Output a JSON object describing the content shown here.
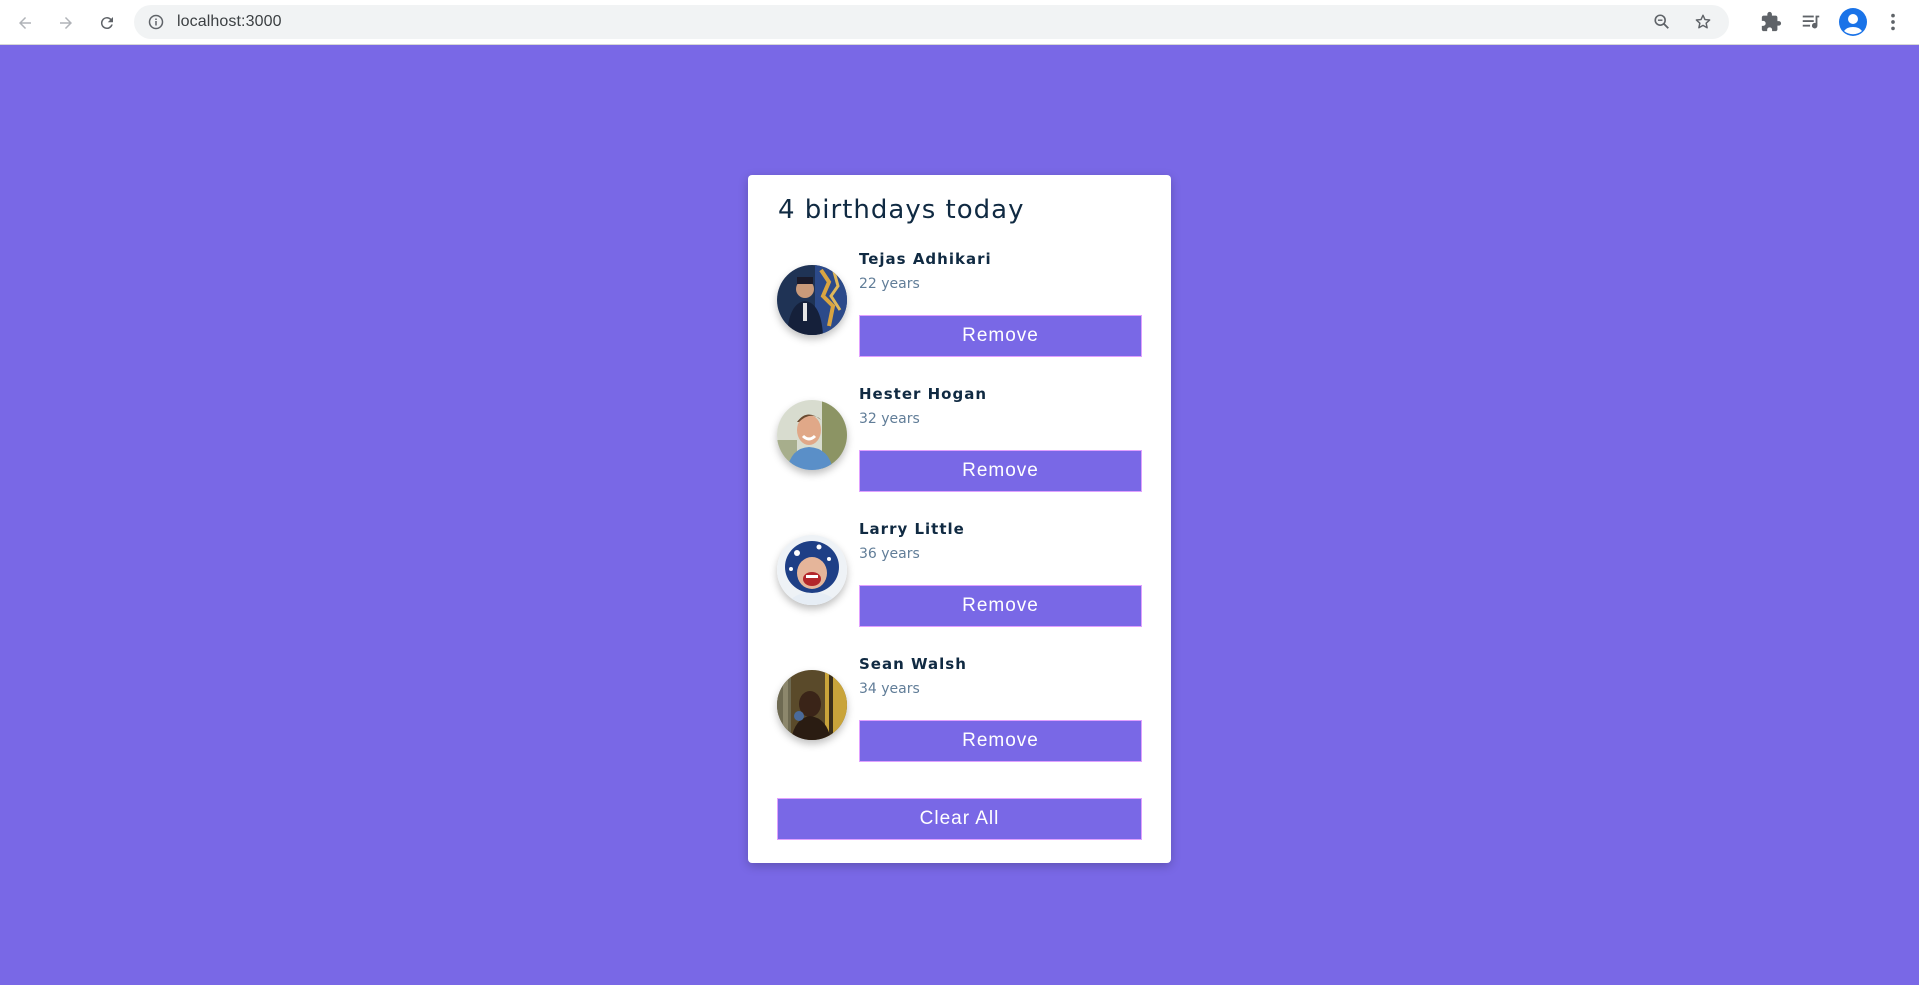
{
  "browser": {
    "url": "localhost:3000"
  },
  "card": {
    "title": "4 birthdays today",
    "people": [
      {
        "name": "Tejas Adhikari",
        "age": "22 years",
        "remove_label": "Remove"
      },
      {
        "name": "Hester Hogan",
        "age": "32 years",
        "remove_label": "Remove"
      },
      {
        "name": "Larry Little",
        "age": "36 years",
        "remove_label": "Remove"
      },
      {
        "name": "Sean Walsh",
        "age": "34 years",
        "remove_label": "Remove"
      }
    ],
    "clear_label": "Clear All"
  },
  "colors": {
    "background": "#7968e6",
    "button": "#7968e6",
    "heading": "#102a42",
    "subtext": "#617d98"
  },
  "icons": [
    "back-icon",
    "forward-icon",
    "reload-icon",
    "info-icon",
    "zoom-icon",
    "star-icon",
    "extensions-icon",
    "media-icon",
    "profile-icon",
    "menu-icon"
  ]
}
